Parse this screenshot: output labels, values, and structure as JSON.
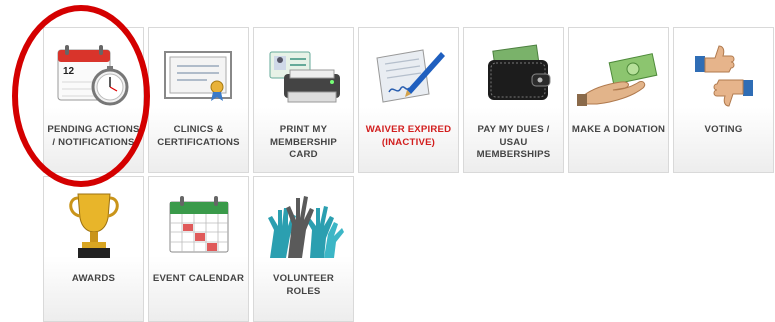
{
  "tiles": [
    {
      "label": "PENDING ACTIONS / NOTIFICATIONS",
      "icon": "calendar-clock-icon",
      "calendar_day": "12"
    },
    {
      "label": "CLINICS & CERTIFICATIONS",
      "icon": "certificate-icon"
    },
    {
      "label": "PRINT MY MEMBERSHIP CARD",
      "icon": "printer-id-card-icon"
    },
    {
      "label": "WAIVER EXPIRED (INACTIVE)",
      "icon": "signed-document-pen-icon",
      "label_color": "#d21d1d"
    },
    {
      "label": "PAY MY DUES / USAU MEMBERSHIPS",
      "icon": "wallet-icon"
    },
    {
      "label": "MAKE A DONATION",
      "icon": "hand-money-icon"
    },
    {
      "label": "VOTING",
      "icon": "thumbs-up-down-icon"
    },
    {
      "label": "AWARDS",
      "icon": "trophy-icon"
    },
    {
      "label": "EVENT CALENDAR",
      "icon": "calendar-icon"
    },
    {
      "label": "VOLUNTEER ROLES",
      "icon": "raised-hands-icon"
    }
  ],
  "highlight": {
    "target": "PENDING ACTIONS / NOTIFICATIONS",
    "color": "#d40000"
  }
}
